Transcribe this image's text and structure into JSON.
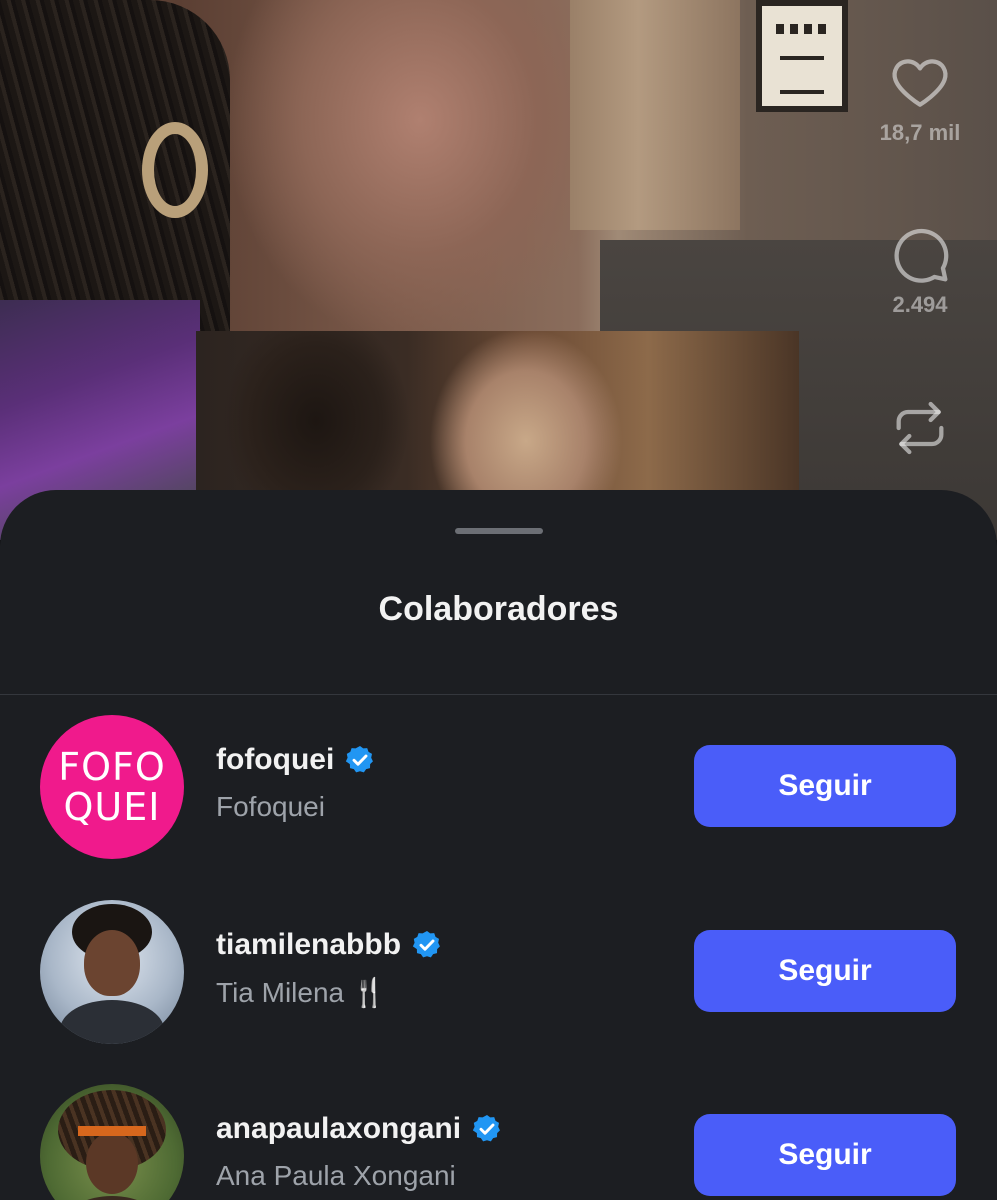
{
  "video": {
    "likes_count": "18,7 mil",
    "comments_count": "2.494"
  },
  "sheet": {
    "title": "Colaboradores"
  },
  "collaborators": [
    {
      "handle": "fofoquei",
      "name": "Fofoquei",
      "verified": true,
      "avatar_text_line1": "FOFO",
      "avatar_text_line2": "QUEI",
      "button": "Seguir"
    },
    {
      "handle": "tiamilenabbb",
      "name": "Tia Milena 🍴",
      "verified": true,
      "button": "Seguir"
    },
    {
      "handle": "anapaulaxongani",
      "name": "Ana Paula Xongani",
      "verified": true,
      "button": "Seguir"
    }
  ],
  "colors": {
    "sheet_bg": "#1c1e22",
    "follow_button": "#4a5df9",
    "verified_badge": "#2196f3",
    "fofoquei_brand": "#f01a8c"
  }
}
